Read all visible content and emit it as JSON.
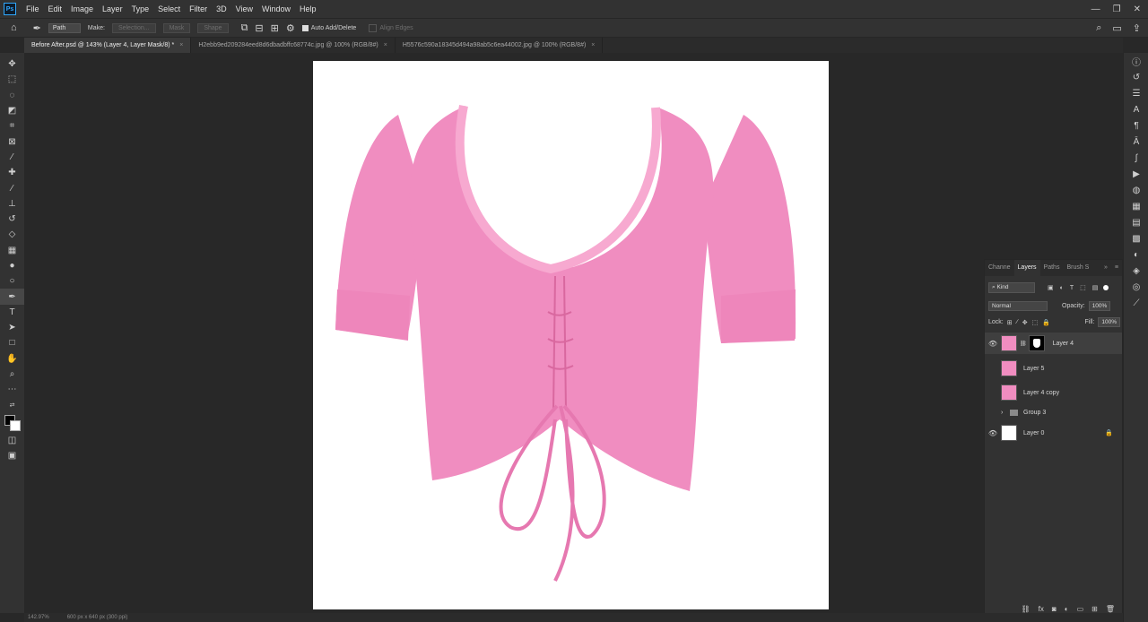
{
  "app": {
    "logo": "Ps"
  },
  "menu": [
    "File",
    "Edit",
    "Image",
    "Layer",
    "Type",
    "Select",
    "Filter",
    "3D",
    "View",
    "Window",
    "Help"
  ],
  "window_controls": {
    "minimize": "—",
    "restore": "❐",
    "close": "✕"
  },
  "options": {
    "mode": "Path",
    "make_label": "Make:",
    "selection_btn": "Selection...",
    "mask_btn": "Mask",
    "shape_btn": "Shape",
    "auto_add_delete": "Auto Add/Delete",
    "align_edges": "Align Edges"
  },
  "tabs": [
    {
      "label": "Before After.psd @ 143% (Layer 4, Layer Mask/8) *",
      "active": true
    },
    {
      "label": "H2ebb9ed209284eed8d6dbadbffc68774c.jpg @ 100% (RGB/8#)",
      "active": false
    },
    {
      "label": "H5576c590a18345d494a98ab5c6ea44002.jpg @ 100% (RGB/8#)",
      "active": false
    }
  ],
  "colors": {
    "shirt": "#f08dc0",
    "shirt_shadow": "#d9689f",
    "highlight": "#f5d300",
    "accent": "#31a8ff"
  },
  "layers_panel": {
    "tabs": [
      "Channe",
      "Layers",
      "Paths",
      "Brush S"
    ],
    "active_tab": "Layers",
    "kind": "Kind",
    "blend_mode": "Normal",
    "opacity_label": "Opacity:",
    "opacity_value": "100%",
    "lock_label": "Lock:",
    "fill_label": "Fill:",
    "fill_value": "100%",
    "layers": [
      {
        "name": "Layer 4",
        "visible": true,
        "selected": true,
        "has_mask": true
      },
      {
        "name": "Layer 5",
        "visible": false,
        "selected": false,
        "has_mask": false
      },
      {
        "name": "Layer 4 copy",
        "visible": false,
        "selected": false,
        "has_mask": false
      },
      {
        "name": "Group 3",
        "visible": false,
        "selected": false,
        "is_group": true
      },
      {
        "name": "Layer 0",
        "visible": true,
        "selected": false,
        "locked": true
      }
    ]
  },
  "status": {
    "zoom": "142.97%",
    "doc_size": "600 px x 640 px (300 ppi)"
  }
}
